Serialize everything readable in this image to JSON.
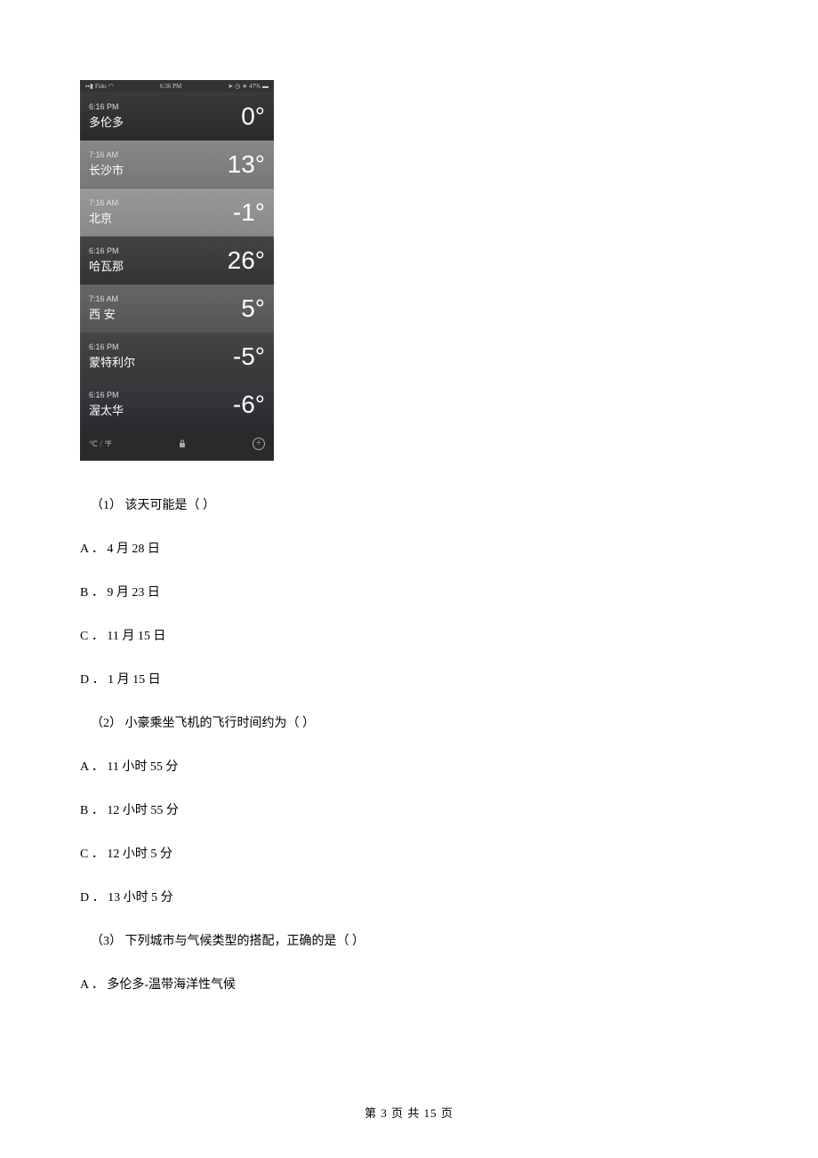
{
  "phone": {
    "status_bar": {
      "carrier": "Fido",
      "center_time": "6:36 PM",
      "battery": "47%"
    },
    "cities": [
      {
        "time": "6:16 PM",
        "name": "多伦多",
        "temp": "0°"
      },
      {
        "time": "7:16 AM",
        "name": "长沙市",
        "temp": "13°"
      },
      {
        "time": "7:16 AM",
        "name": "北京",
        "temp": "-1°"
      },
      {
        "time": "6:16 PM",
        "name": "哈瓦那",
        "temp": "26°"
      },
      {
        "time": "7:16 AM",
        "name": "西 安",
        "temp": "5°"
      },
      {
        "time": "6:16 PM",
        "name": "蒙特利尔",
        "temp": "-5°"
      },
      {
        "time": "6:16 PM",
        "name": "渥太华",
        "temp": "-6°"
      }
    ],
    "bottom_unit": "℃ / ℉"
  },
  "questions": {
    "q1": {
      "stem": "（1） 该天可能是（    ）",
      "options": {
        "A": "A ． 4 月 28 日",
        "B": "B ． 9 月 23 日",
        "C": "C ． 11 月 15 日",
        "D": "D ． 1 月 15 日"
      }
    },
    "q2": {
      "stem": "（2） 小豪乘坐飞机的飞行时间约为（    ）",
      "options": {
        "A": "A ． 11 小时 55 分",
        "B": "B ． 12 小时 55 分",
        "C": "C ． 12 小时 5 分",
        "D": "D ． 13 小时 5 分"
      }
    },
    "q3": {
      "stem": "（3） 下列城市与气候类型的搭配，正确的是（    ）",
      "options": {
        "A": "A ． 多伦多-温带海洋性气候"
      }
    }
  },
  "footer": "第 3 页 共 15 页"
}
